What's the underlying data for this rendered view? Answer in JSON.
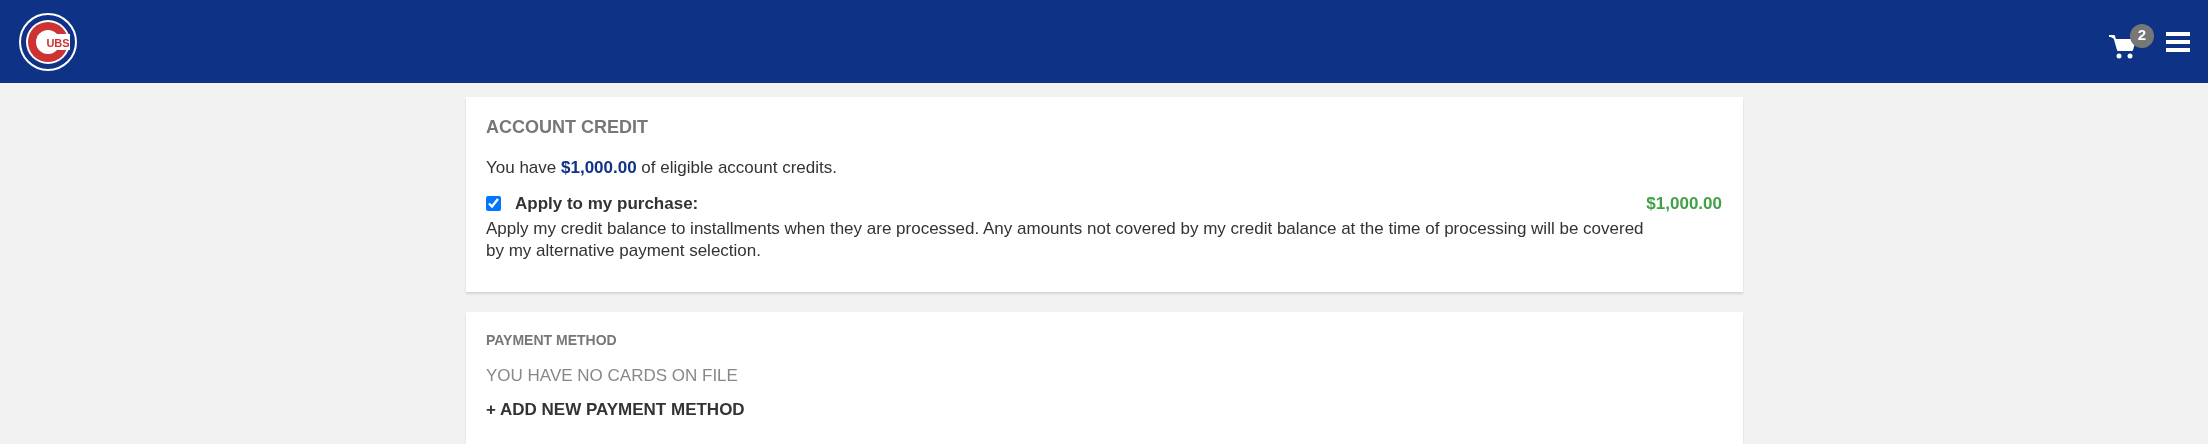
{
  "header": {
    "logo_text": "UBS",
    "cart_count": "2"
  },
  "account_credit": {
    "title": "ACCOUNT CREDIT",
    "summary": "You have **$1,000.00** of eligible account credits.",
    "apply": {
      "label": "Apply to my purchase:",
      "checked": true,
      "amount": "$1,000.00"
    },
    "description": "Apply my credit balance to installments when they are processed. Any amounts not covered by my credit balance at the time of processing will be covered by my alternative payment selection."
  },
  "payment_method": {
    "title": "PAYMENT METHOD",
    "empty_message": "YOU HAVE NO CARDS ON FILE",
    "add_link": "+ ADD NEW PAYMENT METHOD"
  }
}
